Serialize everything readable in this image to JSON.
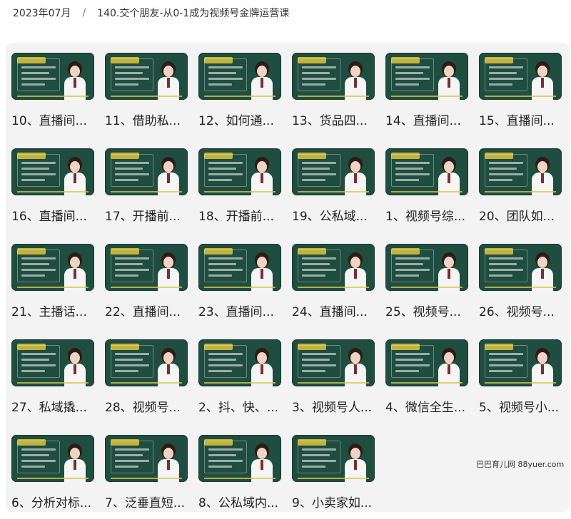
{
  "breadcrumb": {
    "date": "2023年07月",
    "separator": "/",
    "course": "140.交个朋友-从0-1成为视频号金牌运营课"
  },
  "lessons": [
    "10、直播间...",
    "11、借助私...",
    "12、如何通...",
    "13、货品四...",
    "14、直播间...",
    "15、直播间...",
    "16、直播间...",
    "17、开播前...",
    "18、开播前...",
    "19、公私域...",
    "1、视频号综...",
    "20、团队如...",
    "21、主播话...",
    "22、直播间...",
    "23、直播间...",
    "24、直播间...",
    "25、视频号...",
    "26、视频号...",
    "27、私域撬...",
    "28、视频号...",
    "2、抖、快、...",
    "3、视频号人...",
    "4、微信全生...",
    "5、视频号小...",
    "6、分析对标...",
    "7、泛垂直短...",
    "8、公私域内...",
    "9、小卖家如..."
  ],
  "watermark": "巴巴育儿网 88yuer.com",
  "colors": {
    "board": "#1f4d3f",
    "accent": "#d6c84a"
  }
}
